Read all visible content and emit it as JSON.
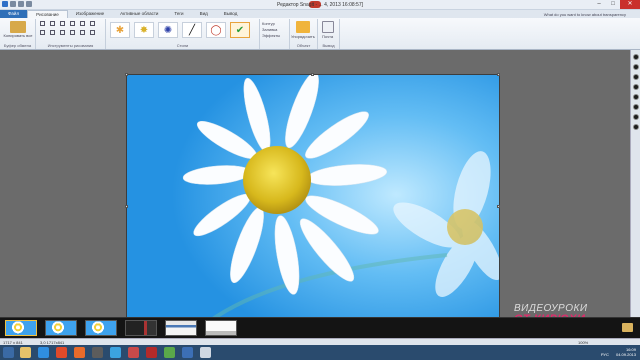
{
  "window": {
    "title": "Редактор Snagit - ... 4, 2013 16:08:57]"
  },
  "tabs": [
    {
      "label": "Файл"
    },
    {
      "label": "Рисование"
    },
    {
      "label": "Изображение"
    },
    {
      "label": "Активные области"
    },
    {
      "label": "Теги"
    },
    {
      "label": "Вид"
    },
    {
      "label": "Вывод"
    }
  ],
  "help_text": "What do you want to know about transparency",
  "ribbon": {
    "clipboard": {
      "paste_label": "Копировать все",
      "group_label": "Буфер обмена"
    },
    "tools": {
      "group_label": "Инструменты рисования"
    },
    "styles": {
      "group_label": "Стили"
    },
    "effects": {
      "contour": "Контур",
      "fill": "Заливка",
      "effects": "Эффекты"
    },
    "object": {
      "btn_label": "Упорядочить",
      "group_label": "Объект"
    },
    "output": {
      "btn_label": "Почта",
      "group_label": "Вывод"
    }
  },
  "statusbar": {
    "size": "1717 x 841",
    "zoom_pct": "100%",
    "coords": "3,0 1717x841",
    "lang": "РУС"
  },
  "watermark": {
    "line1": "ВИДЕОУРОКИ",
    "line2": "ОТ КИРЮХИ"
  },
  "tray": {
    "time": "16:09",
    "date": "04.09.2013"
  },
  "colors": {
    "accent": "#2f6fb8",
    "selected_style": "#e8a33c",
    "watermark_pink": "#e02a6b"
  }
}
